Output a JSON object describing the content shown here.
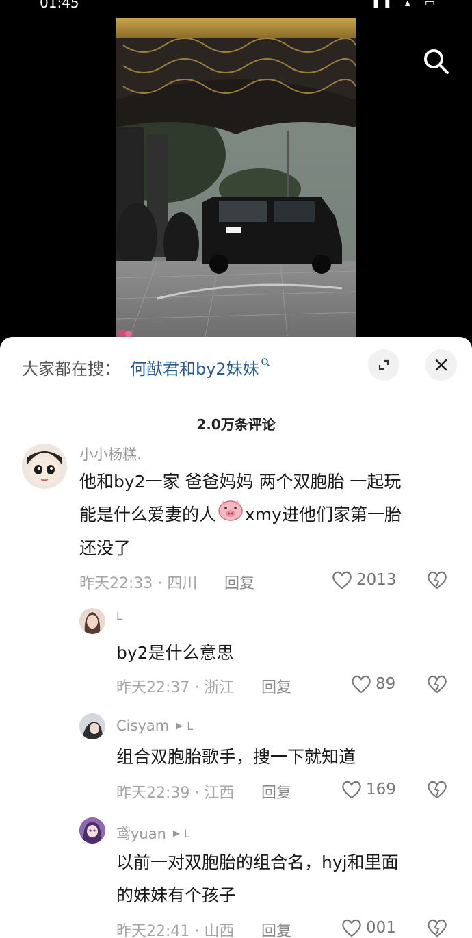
{
  "status_bar": {
    "time": "01:45"
  },
  "search_suggestion": {
    "prefix": "大家都在搜：",
    "query": "何猷君和by2妹妹"
  },
  "comments_header": {
    "count_label": "2.0万条评论"
  },
  "comments": [
    {
      "username": "小小杨糕.",
      "text_lines": [
        "他和by2一家 爸爸妈妈 两个双胞胎 一起玩",
        "能是什么爱妻的人",
        "xmy进他们家第一胎",
        "还没了"
      ],
      "meta": "昨天22:33 · 四川",
      "reply_label": "回复",
      "likes": "2013"
    },
    {
      "username": "L",
      "text": "by2是什么意思",
      "meta": "昨天22:37 · 浙江",
      "reply_label": "回复",
      "likes": "89"
    },
    {
      "username": "Cisyam",
      "reply_to": "L",
      "text": "组合双胞胎歌手，搜一下就知道",
      "meta": "昨天22:39 · 江西",
      "reply_label": "回复",
      "likes": "169"
    },
    {
      "username": "鸢yuan",
      "reply_to": "L",
      "text_lines": [
        "以前一对双胞胎的组合名，hyj和里面",
        "的妹妹有个孩子"
      ],
      "meta": "昨天22:41 · 山西",
      "reply_label": "回复",
      "likes": "001"
    }
  ]
}
